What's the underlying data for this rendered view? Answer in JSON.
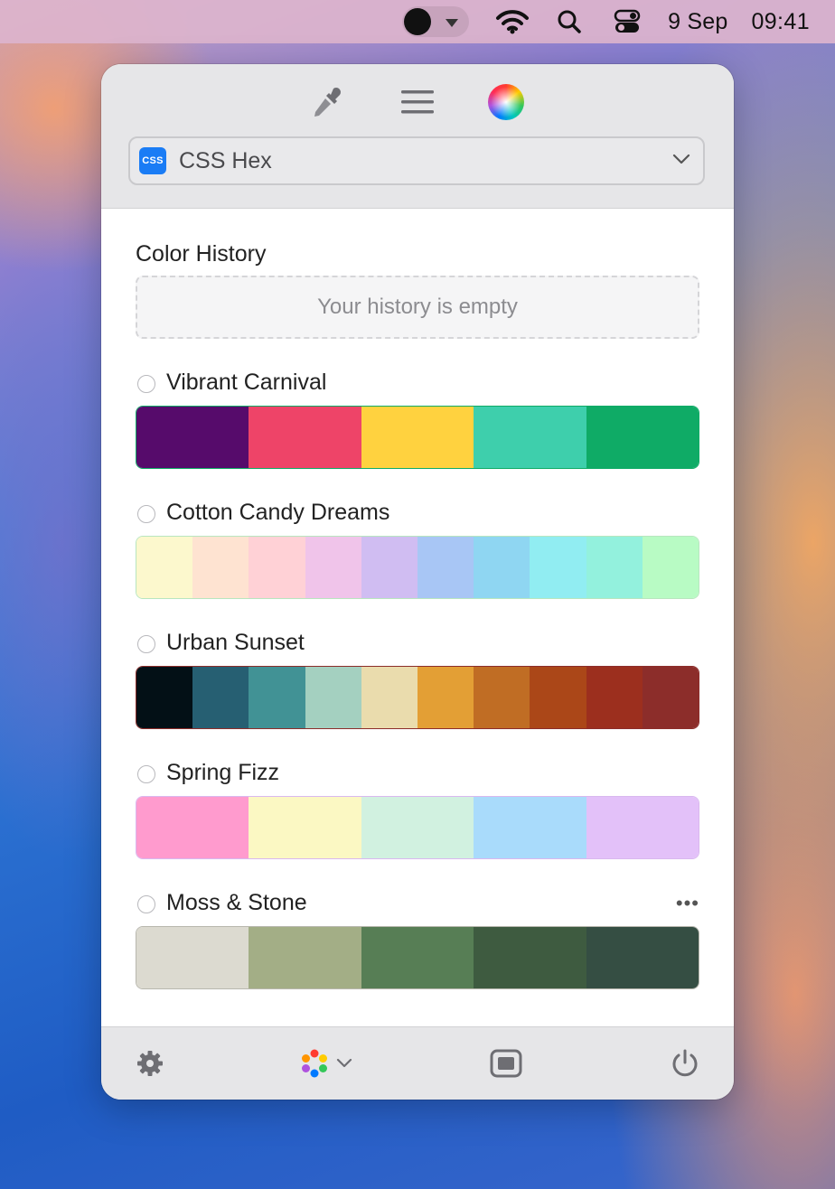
{
  "menubar": {
    "date": "9 Sep",
    "time": "09:41",
    "icons": [
      "app-menu-icon",
      "wifi-icon",
      "search-icon",
      "control-center-icon"
    ]
  },
  "toolbar": {
    "icons": [
      "eyedropper-icon",
      "list-icon",
      "color-wheel-icon"
    ],
    "format_badge": "CSS",
    "format_label": "CSS Hex"
  },
  "history": {
    "title": "Color History",
    "empty_text": "Your history is empty"
  },
  "palettes": [
    {
      "name": "Vibrant Carnival",
      "colors": [
        "#560b6b",
        "#ee4468",
        "#ffd23f",
        "#3ecfac",
        "#0fab66"
      ],
      "border": "#0fab66"
    },
    {
      "name": "Cotton Candy Dreams",
      "colors": [
        "#fcf8cd",
        "#fee3d1",
        "#ffd1d6",
        "#f0c4ea",
        "#d0bdf2",
        "#a8c6f5",
        "#8fd6f2",
        "#91edf2",
        "#93f1dd",
        "#b8fbc4"
      ],
      "border": "#b8e6bf"
    },
    {
      "name": "Urban Sunset",
      "colors": [
        "#031016",
        "#265f72",
        "#419295",
        "#a4d0c0",
        "#eadcad",
        "#e39f35",
        "#c06d24",
        "#ab4718",
        "#9c2f1e",
        "#8c2d2a"
      ],
      "border": "#8c2d2a"
    },
    {
      "name": "Spring Fizz",
      "colors": [
        "#ff9bce",
        "#fbf8c3",
        "#d1f1e0",
        "#a9dbfb",
        "#e3c1f9"
      ],
      "border": "#d9b8ef"
    },
    {
      "name": "Moss & Stone",
      "colors": [
        "#dcdad0",
        "#a3ae86",
        "#577e55",
        "#3e5b40",
        "#354e43"
      ],
      "border": "#b8b7ae",
      "more": "•••"
    }
  ],
  "bottombar": {
    "icons": [
      "settings-gear-icon",
      "color-palette-icon",
      "chevron-down-icon",
      "window-icon",
      "power-icon"
    ]
  }
}
